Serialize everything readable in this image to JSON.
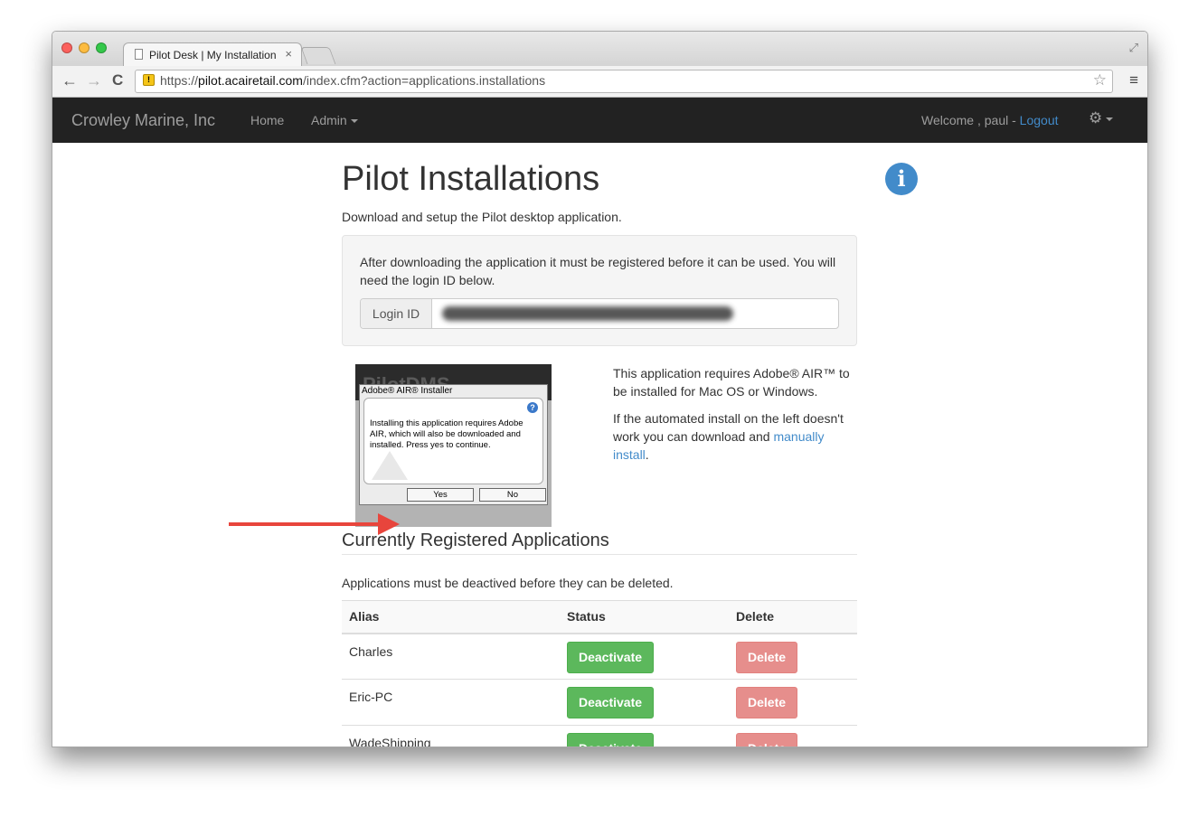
{
  "browser": {
    "tab_title": "Pilot Desk | My Installation",
    "tab_close": "×",
    "url_prefix": "https://",
    "url_host": "pilot.acairetail.com",
    "url_path": "/index.cfm?action=applications.installations",
    "back": "←",
    "forward": "→",
    "reload": "C",
    "star": "☆",
    "menu": "≡",
    "resize": "⤢",
    "lock": "!"
  },
  "navbar": {
    "brand": "Crowley Marine, Inc",
    "home": "Home",
    "admin": "Admin",
    "welcome": "Welcome , paul - ",
    "logout": "Logout",
    "gear": "⚙"
  },
  "page": {
    "title": "Pilot Installations",
    "lead": "Download and setup the Pilot desktop application.",
    "info_icon": "i",
    "well_text": "After downloading the application it must be registered before it can be used. You will need the login ID below.",
    "login_label": "Login ID"
  },
  "air_installer": {
    "logo": "PilotDMS",
    "dialog_title": "Adobe® AIR® Installer",
    "help": "?",
    "message": "Installing this application requires Adobe AIR, which will also be downloaded and installed. Press yes to continue.",
    "yes": "Yes",
    "no": "No"
  },
  "air_info": {
    "p1": "This application requires Adobe® AIR™ to be installed for Mac OS or Windows.",
    "p2_pre": "If the automated install on the left doesn't work you can download and ",
    "p2_link": "manually install",
    "p2_post": "."
  },
  "registered": {
    "heading": "Currently Registered Applications",
    "note": "Applications must be deactived before they can be deleted.",
    "columns": [
      "Alias",
      "Status",
      "Delete"
    ],
    "rows": [
      {
        "alias": "Charles",
        "status_button": "Deactivate",
        "delete_button": "Delete"
      },
      {
        "alias": "Eric-PC",
        "status_button": "Deactivate",
        "delete_button": "Delete"
      },
      {
        "alias": "WadeShipping",
        "status_button": "Deactivate",
        "delete_button": "Delete"
      }
    ]
  },
  "colors": {
    "navbar": "#222222",
    "link": "#428bca",
    "success": "#5cb85c",
    "danger": "#d9534f",
    "arrow": "#e8453c"
  }
}
